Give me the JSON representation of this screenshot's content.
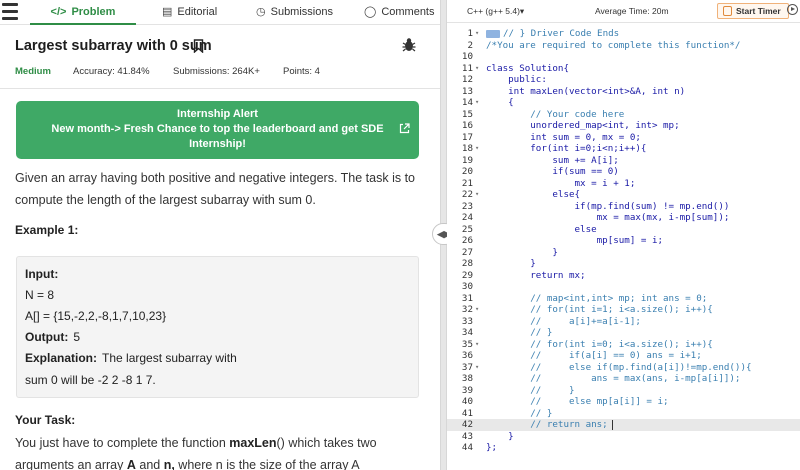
{
  "tabs": {
    "problem": "Problem",
    "editorial": "Editorial",
    "submissions": "Submissions",
    "comments": "Comments"
  },
  "problem": {
    "title": "Largest subarray with 0 sum",
    "difficulty": "Medium",
    "accuracy": "Accuracy: 41.84%",
    "submissions": "Submissions: 264K+",
    "points": "Points: 4"
  },
  "alert": {
    "line1": "Internship Alert",
    "line2": "New month-> Fresh Chance to top the leaderboard and get SDE",
    "line3": "Internship!"
  },
  "description": {
    "line1": "Given an array having both positive and negative integers. The task is to",
    "line2": "compute the length of the largest subarray with sum 0."
  },
  "example": {
    "title": "Example 1:",
    "input_label": "Input:",
    "n_line": "N = 8",
    "arr_line": "A[] = {15,-2,2,-8,1,7,10,23}",
    "output_label": "Output:",
    "output_value": "5",
    "explanation_label": "Explanation:",
    "explanation_line1": "The  largest  subarray  with",
    "explanation_line2": "sum  0  will  be  -2  2  -8  1  7."
  },
  "task": {
    "title": "Your Task:",
    "line1_pre": "You just have to complete the function ",
    "line1_fn": "maxLen",
    "line1_post": "() which takes two",
    "line2_pre": "arguments an array ",
    "line2_a": "A",
    "line2_mid": " and ",
    "line2_n": "n,",
    "line2_post": " where n is the size of the array A"
  },
  "editor_bar": {
    "language": "C++ (g++ 5.4)▾",
    "avg_time": "Average Time: 20m",
    "start_timer": "Start Timer"
  },
  "code_lines": [
    {
      "n": "1",
      "fold": true,
      "text": "// } Driver Code Ends"
    },
    {
      "n": "2",
      "fold": false,
      "text": "/*You are required to complete this function*/"
    },
    {
      "n": "10",
      "fold": false,
      "text": ""
    },
    {
      "n": "11",
      "fold": true,
      "text": "class Solution{"
    },
    {
      "n": "12",
      "fold": false,
      "text": "    public:"
    },
    {
      "n": "13",
      "fold": false,
      "text": "    int maxLen(vector<int>&A, int n)"
    },
    {
      "n": "14",
      "fold": true,
      "text": "    {"
    },
    {
      "n": "15",
      "fold": false,
      "text": "        // Your code here"
    },
    {
      "n": "16",
      "fold": false,
      "text": "        unordered_map<int, int> mp;"
    },
    {
      "n": "17",
      "fold": false,
      "text": "        int sum = 0, mx = 0;"
    },
    {
      "n": "18",
      "fold": true,
      "text": "        for(int i=0;i<n;i++){"
    },
    {
      "n": "19",
      "fold": false,
      "text": "            sum += A[i];"
    },
    {
      "n": "20",
      "fold": false,
      "text": "            if(sum == 0)"
    },
    {
      "n": "21",
      "fold": false,
      "text": "                mx = i + 1;"
    },
    {
      "n": "22",
      "fold": true,
      "text": "            else{"
    },
    {
      "n": "23",
      "fold": false,
      "text": "                if(mp.find(sum) != mp.end())"
    },
    {
      "n": "24",
      "fold": false,
      "text": "                    mx = max(mx, i-mp[sum]);"
    },
    {
      "n": "25",
      "fold": false,
      "text": "                else"
    },
    {
      "n": "26",
      "fold": false,
      "text": "                    mp[sum] = i;"
    },
    {
      "n": "27",
      "fold": false,
      "text": "            }"
    },
    {
      "n": "28",
      "fold": false,
      "text": "        }"
    },
    {
      "n": "29",
      "fold": false,
      "text": "        return mx;"
    },
    {
      "n": "30",
      "fold": false,
      "text": ""
    },
    {
      "n": "31",
      "fold": false,
      "text": "        // map<int,int> mp; int ans = 0;"
    },
    {
      "n": "32",
      "fold": true,
      "text": "        // for(int i=1; i<a.size(); i++){"
    },
    {
      "n": "33",
      "fold": false,
      "text": "        //     a[i]+=a[i-1];"
    },
    {
      "n": "34",
      "fold": false,
      "text": "        // }"
    },
    {
      "n": "35",
      "fold": true,
      "text": "        // for(int i=0; i<a.size(); i++){"
    },
    {
      "n": "36",
      "fold": false,
      "text": "        //     if(a[i] == 0) ans = i+1;"
    },
    {
      "n": "37",
      "fold": true,
      "text": "        //     else if(mp.find(a[i])!=mp.end()){"
    },
    {
      "n": "38",
      "fold": false,
      "text": "        //         ans = max(ans, i-mp[a[i]]);"
    },
    {
      "n": "39",
      "fold": false,
      "text": "        //     }"
    },
    {
      "n": "40",
      "fold": false,
      "text": "        //     else mp[a[i]] = i;"
    },
    {
      "n": "41",
      "fold": false,
      "text": "        // }"
    },
    {
      "n": "42",
      "fold": false,
      "text": "        // return ans;"
    },
    {
      "n": "43",
      "fold": false,
      "text": "    }"
    },
    {
      "n": "44",
      "fold": false,
      "text": "};"
    }
  ],
  "colors": {
    "brand_green": "#2f8d46",
    "alert_bg": "#3fa966",
    "code_blue": "#1a1aa6",
    "comment": "#3a7fb0"
  }
}
